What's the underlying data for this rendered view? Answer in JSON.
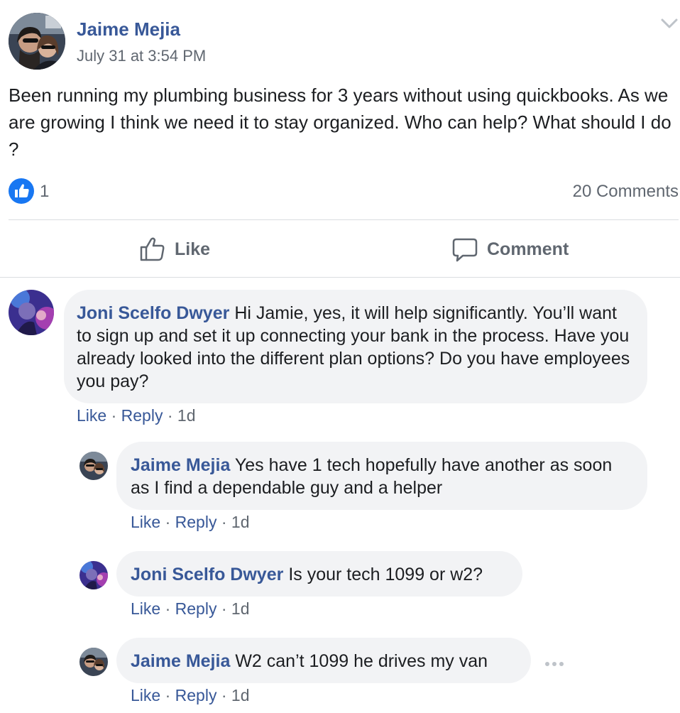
{
  "post": {
    "author": "Jaime Mejia",
    "timestamp": "July 31 at 3:54 PM",
    "text": "Been running my plumbing business for 3 years without using quickbooks. As we are growing I think we need it to stay organized. Who can help? What should I do ?",
    "like_count": "1",
    "comments_count": "20 Comments"
  },
  "actions": {
    "like_label": "Like",
    "comment_label": "Comment"
  },
  "comments": [
    {
      "author": "Joni Scelfo Dwyer",
      "text": "Hi Jamie, yes, it will help significantly. You’ll want to sign up and set it up connecting your bank in the process. Have you already looked into the different plan options? Do you have employees you pay?",
      "like": "Like",
      "reply": "Reply",
      "age": "1d"
    },
    {
      "author": "Jaime Mejia",
      "text": "Yes have 1 tech hopefully have another as soon as I find a dependable guy and a helper",
      "like": "Like",
      "reply": "Reply",
      "age": "1d"
    },
    {
      "author": "Joni Scelfo Dwyer",
      "text": "Is your tech 1099 or w2?",
      "like": "Like",
      "reply": "Reply",
      "age": "1d"
    },
    {
      "author": "Jaime Mejia",
      "text": "W2 can’t 1099 he drives my van",
      "like": "Like",
      "reply": "Reply",
      "age": "1d"
    }
  ],
  "meta_separator": " · ",
  "icons": {
    "post_menu": "chevron-down-icon",
    "reaction": "thumbs-up-icon",
    "like_action": "thumbs-up-outline-icon",
    "comment_action": "speech-bubble-icon",
    "comment_menu": "more-horizontal-icon"
  },
  "colors": {
    "name_link": "#385898",
    "secondary_text": "#606770",
    "like_blue": "#1877f2",
    "bubble_bg": "#f2f3f5"
  }
}
